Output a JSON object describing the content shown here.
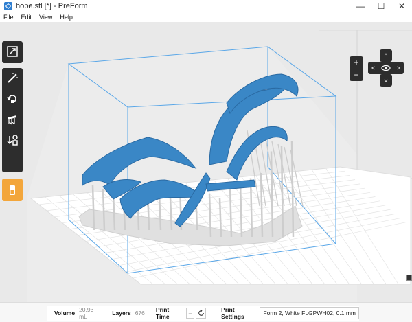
{
  "window": {
    "title": "hope.stl [*] - PreForm",
    "min_glyph": "—",
    "max_glyph": "☐",
    "close_glyph": "✕"
  },
  "menu": [
    "File",
    "Edit",
    "View",
    "Help"
  ],
  "viewport": {
    "zoom_in": "+",
    "zoom_out": "−",
    "nav_up": "^",
    "nav_down": "v",
    "nav_left": "<",
    "nav_right": ">",
    "model_color": "#3a87c6",
    "support_color": "#d6d6d6",
    "build_volume_color": "#5aa7e8"
  },
  "status": {
    "volume_label": "Volume",
    "volume_value": "20.93 mL",
    "layers_label": "Layers",
    "layers_value": "676",
    "print_time_label": "Print Time",
    "print_time_value": "–",
    "print_settings_label": "Print Settings",
    "print_settings_value": "Form 2, White FLGPWH02, 0.1 mm"
  }
}
